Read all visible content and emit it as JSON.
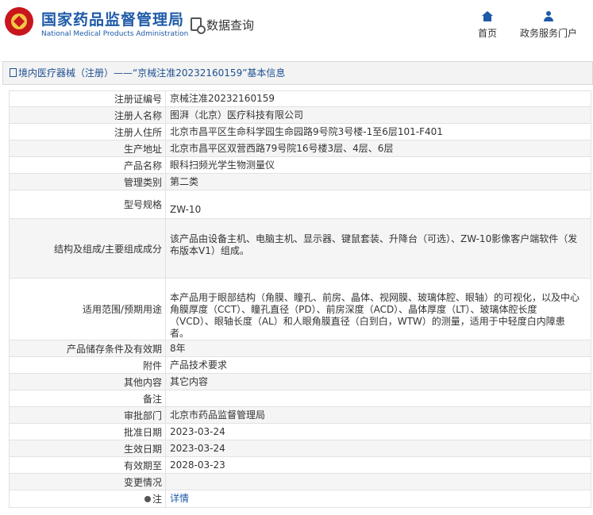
{
  "header": {
    "org_name_cn": "国家药品监督管理局",
    "org_name_en": "National Medical Products Administration",
    "query_label": "数据查询",
    "nav": [
      {
        "label": "首页",
        "icon": "home-icon"
      },
      {
        "label": "政务服务门户",
        "icon": "user-icon"
      }
    ]
  },
  "breadcrumb": "境内医疗器械（注册）——“京械注准20232160159”基本信息",
  "rows": [
    {
      "label": "注册证编号",
      "value": "京械注准20232160159"
    },
    {
      "label": "注册人名称",
      "value": "图湃（北京）医疗科技有限公司"
    },
    {
      "label": "注册人住所",
      "value": "北京市昌平区生命科学园生命园路9号院3号楼-1至6层101-F401"
    },
    {
      "label": "生产地址",
      "value": "北京市昌平区双营西路79号院16号楼3层、4层、6层"
    },
    {
      "label": "产品名称",
      "value": "眼科扫频光学生物测量仪"
    },
    {
      "label": "管理类别",
      "value": "第二类"
    },
    {
      "label": "型号规格",
      "value": "ZW-10"
    },
    {
      "label": "结构及组成/主要组成成分",
      "value": "该产品由设备主机、电脑主机、显示器、键鼠套装、升降台（可选）、ZW-10影像客户端软件（发布版本V1）组成。"
    },
    {
      "label": "适用范围/预期用途",
      "value": "本产品用于眼部结构（角膜、瞳孔、前房、晶体、视网膜、玻璃体腔、眼轴）的可视化，以及中心角膜厚度（CCT）、瞳孔直径（PD）、前房深度（ACD）、晶体厚度（LT）、玻璃体腔长度（VCD）、眼轴长度（AL）和人眼角膜直径（白到白，WTW）的测量，适用于中轻度白内障患者。"
    },
    {
      "label": "产品储存条件及有效期",
      "value": "8年"
    },
    {
      "label": "附件",
      "value": "产品技术要求"
    },
    {
      "label": "其他内容",
      "value": "其它内容"
    },
    {
      "label": "备注",
      "value": ""
    },
    {
      "label": "审批部门",
      "value": "北京市药品监督管理局"
    },
    {
      "label": "批准日期",
      "value": "2023-03-24"
    },
    {
      "label": "生效日期",
      "value": "2023-03-24"
    },
    {
      "label": "有效期至",
      "value": "2028-03-23"
    },
    {
      "label": "变更情况",
      "value": ""
    }
  ],
  "note_row": {
    "label": "注",
    "link_text": "详情"
  }
}
